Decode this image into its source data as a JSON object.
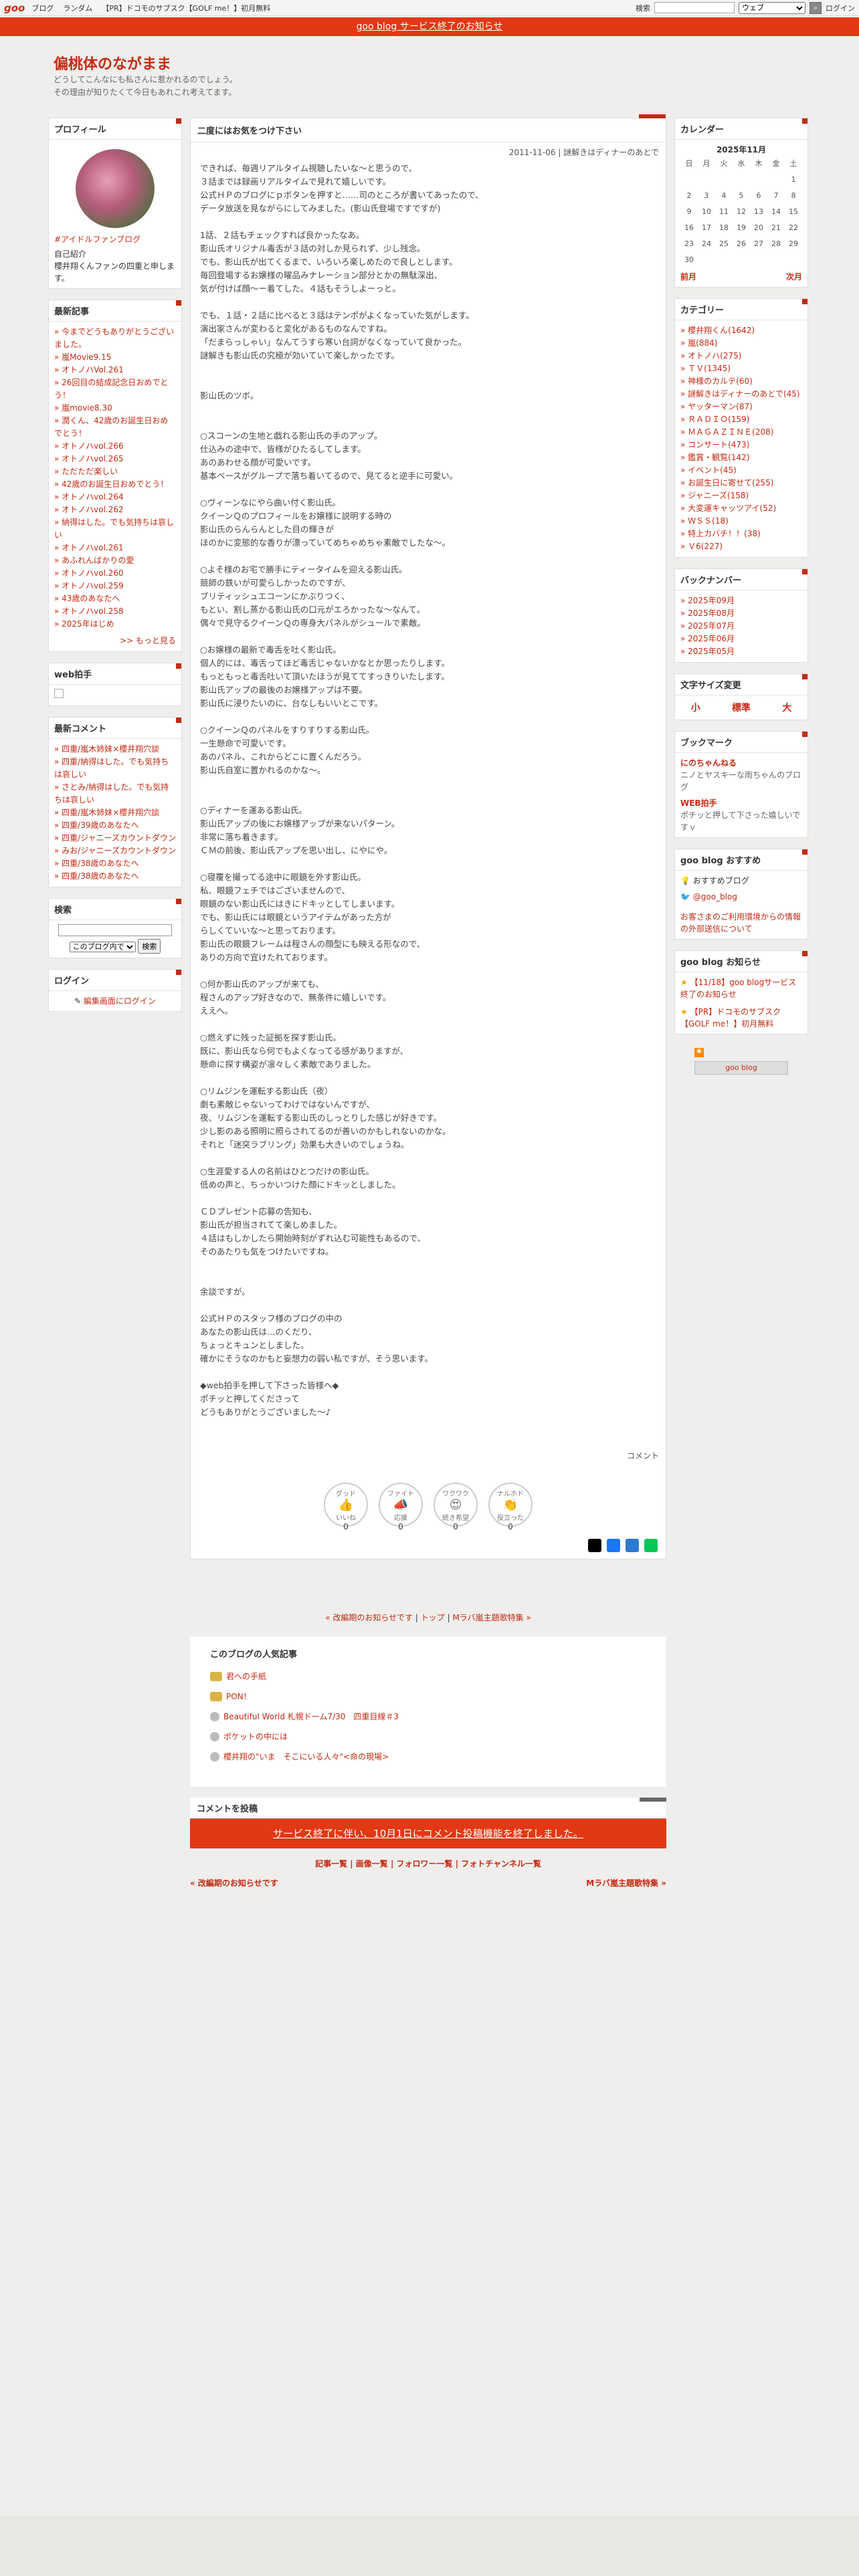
{
  "topbar": {
    "logo": "goo",
    "links": [
      "ブログ",
      "ランダム",
      "【PR】ドコモのサブスク【GOLF me！】初月無料"
    ],
    "search_label": "検索",
    "search_select": "ウェブ",
    "login": "ログイン"
  },
  "notice": "goo blog サービス終了のお知らせ",
  "blog": {
    "title": "偏桃体のながまま",
    "desc": "どうしてこんなにも私さんに惹かれるのでしょう。\nその理由が知りたくて今日もあれこれ考えてます。"
  },
  "profile": {
    "title": "プロフィール",
    "tag": "#アイドルファンブログ",
    "intro_label": "自己紹介",
    "intro": "櫻井翔くんファンの四重と申します。"
  },
  "recent": {
    "title": "最新記事",
    "items": [
      "今までどうもありがとうございました。",
      "嵐Movie9.15",
      "オトノハVol.261",
      "26回目の結成記念日おめでとう！",
      "嵐movie8.30",
      "潤くん、42歳のお誕生日おめでとう！",
      "オトノハvol.266",
      "オトノハvol.265",
      "ただただ楽しい",
      "42歳のお誕生日おめでとう！",
      "オトノハvol.264",
      "オトノハvol.262",
      "納得はした。でも気持ちは哀しい",
      "オトノハvol.261",
      "あふれんばかりの愛",
      "オトノハvol.260",
      "オトノハvol.259",
      "43歳のあなたへ",
      "オトノハvol.258",
      "2025年はじめ"
    ],
    "more": ">> もっと見る"
  },
  "webclap": {
    "title": "web拍手"
  },
  "comments": {
    "title": "最新コメント",
    "items": [
      "四重/嵐木姉妹×櫻井翔穴談",
      "四重/納得はした。でも気持ちは哀しい",
      "さとみ/納得はした。でも気持ちは哀しい",
      "四重/嵐木姉妹×櫻井翔穴談",
      "四重/39歳のあなたへ",
      "四重/ジャニーズカウントダウン",
      "みお/ジャニーズカウントダウン",
      "四重/38歳のあなたへ",
      "四重/38歳のあなたへ"
    ]
  },
  "search": {
    "title": "検索",
    "select": "このブログ内で",
    "button": "検索"
  },
  "login": {
    "title": "ログイン",
    "link": "編集画面にログイン"
  },
  "post": {
    "title": "二度にはお気をつけ下さい",
    "meta": "2011-11-06 | 謎解きはディナーのあとで",
    "body": "できれば、毎週リアルタイム視聴したいな～と思うので、\n３話までは録画リアルタイムで見れて嬉しいです。\n公式ＨＰのブログにｐボタンを押すと……司のところが書いてあったので、\nデータ放送を見ながらにしてみました。(影山氏登場ですですが)\n\n1話、２話もチェックすれば良かったなあ。\n影山氏オリジナル毒舌が３話の対しか見られず、少し残念。\nでも、影山氏が出てくるまで、いろいろ楽しめたので良しとします。\n毎回登場するお嬢様の曜品みナレーション部分とかの無駄深出、\n気が付けば顔〜ー着てした。４話もそうしよーっと。\n\nでも、１話・２話に比べると３話はテンポがよくなっていた気がします。\n演出家さんが変わると変化があるものなんですね。\n「だまらっしゃい」なんてうすら寒い台詞がなくなっていて良かった。\n謎解きも影山氏の究極が効いていて楽しかったです。\n\n\n影山氏のツボ。\n\n\n○スコーンの生地と戯れる影山氏の手のアップ。\n仕込みの途中で、皆様がひたるしてします。\nあのあわせる顔が可愛いです。\n基本ベースがグループで落ち着いてるので、見てると逆手に可愛い。\n\n○ヴィーンなにやら曲い付く影山氏。\nクイーンＱのプロフィールをお嬢様に説明する時の\n影山氏のらんらんとした目の輝きが\nほのかに変態的な香りが漂っていてめちゃめちゃ素敵でしたな〜。\n\n○よそ様のお宅で勝手にティータイムを迎える影山氏。\n競師の鉄いが可愛らしかったのですが、\nブリティッシュエコーンにかぶりつく、\nもとい、割し蒸かる影山氏の口元がエろかったな〜なんて。\n偶々で見守るクイーンＱの専身大パネルがシュールで素敵。\n\n○お嬢様の最新で毒舌を吐く影山氏。\n個人的には、毒舌ってほど毒舌じゃないかなとか思ったりします。\nもっともっと毒舌吐いて頂いたほうが見ててすっきりいたします。\n影山氏アップの最後のお嬢様アップは不要。\n影山氏に浸りたいのに、台なしもいいとこです。\n\n○クイーンＱのパネルをすりすりする影山氏。\n一生懸命で可愛いです。\nあのパネル、これからどこに置くんだろう。\n影山氏自室に置かれるのかな〜。\n\n\n○ディナーを運ある影山氏。\n影山氏アップの後にお嬢様アップが来ないパターン。\n非常に落ち着きます。\nＣＭの前後、影山氏アップを思い出し、にやにや。\n\n○寝覆を撮ってる途中に眼鏡を外す影山氏。\n私、眼鏡フェチではございませんので、\n眼鏡のない影山氏にはきにドキッとしてしまいます。\nでも、影山氏には眼鏡というアイテムがあった方が\nらしくていいな〜と思っております。\n影山氏の眼鏡フレームは程さんの顔型にも映える形なので、\nありの方向で宜けたれております。\n\n○何か影山氏のアップが来ても、\n程さんのアップ好きなので、無条件に嬉しいです。\nええへ。\n\n○燃えずに残った証拠を探す影山氏。\n既に、影山氏なら何でもよくなってる感がありますが、\n懸命に探す構姿が凛々しく素敵でありました。\n\n○リムジンを運転する影山氏（夜）\n劇も素敵じゃないってわけではないんですが、\n夜、リムジンを運転する影山氏のしっとりした感じが好きです。\n少し影のある照明に照らされてるのが善いのかもしれないのかな。\nそれと「迷突ラブリング」効果も大きいのでしょうね。\n\n○生涯愛する人の名前はひとつだけの影山氏。\n低めの声と、ちっかいつけた顔にドキッとしました。\n\nＣＤプレゼント応募の告知も、\n影山氏が担当されてて楽しめました。\n４話はもしかしたら開始時刻がずれ込む可能性もあるので、\nそのあたりも気をつけたいですね。\n\n\n余談ですが。\n\n公式ＨＰのスタッフ様のブログの中の\nあなたの影山氏は…のくだり、\nちょっとキュンとしました。\n確かにそうなのかもと妄想力の弱い私ですが、そう思います。\n\n◆web拍手を押して下さった皆様へ◆\nポチッと押してくださって\nどうもありがとうございました〜♪",
    "comment_label": "コメント"
  },
  "reactions": [
    {
      "top": "グッド",
      "label": "いいね",
      "count": "0",
      "emoji": "👍"
    },
    {
      "top": "ファイト",
      "label": "応援",
      "count": "0",
      "emoji": "📣"
    },
    {
      "top": "ワクワク",
      "label": "続き希望",
      "count": "0",
      "emoji": "😍"
    },
    {
      "top": "ナルホド",
      "label": "役立った",
      "count": "0",
      "emoji": "👏"
    }
  ],
  "share_colors": [
    "#000000",
    "#1877f2",
    "#2e7ad1",
    "#06c755"
  ],
  "nav": {
    "prev": "« 改編期のお知らせです",
    "top": "トップ",
    "next": "Mラバ嵐主題歌特集 »"
  },
  "popular": {
    "title": "このブログの人気記事",
    "items": [
      "君への手紙",
      "PON！",
      "Beautiful World 札幌ドーム7/30　四重目線＃3",
      "ポケットの中には",
      "櫻井翔の\"いま　そこにいる人々\"<命の現場>"
    ]
  },
  "comment_post": {
    "title": "コメントを投稿",
    "closed": "サービス終了に伴い、10月1日にコメント投稿機能を終了しました。"
  },
  "footer_links": "記事一覧 | 画像一覧 | フォロワー一覧 | フォトチャンネル一覧",
  "footer_prev": "« 改編期のお知らせです",
  "footer_next": "Mラバ嵐主題歌特集 »",
  "calendar": {
    "title": "カレンダー",
    "month": "2025年11月",
    "days": [
      "日",
      "月",
      "火",
      "水",
      "木",
      "金",
      "土"
    ],
    "weeks": [
      [
        "",
        "",
        "",
        "",
        "",
        "",
        "1"
      ],
      [
        "2",
        "3",
        "4",
        "5",
        "6",
        "7",
        "8"
      ],
      [
        "9",
        "10",
        "11",
        "12",
        "13",
        "14",
        "15"
      ],
      [
        "16",
        "17",
        "18",
        "19",
        "20",
        "21",
        "22"
      ],
      [
        "23",
        "24",
        "25",
        "26",
        "27",
        "28",
        "29"
      ],
      [
        "30",
        "",
        "",
        "",
        "",
        "",
        ""
      ]
    ],
    "prev": "前月",
    "next": "次月"
  },
  "categories": {
    "title": "カテゴリー",
    "items": [
      "櫻井翔くん(1642)",
      "嵐(884)",
      "オトノハ(275)",
      "ＴＶ(1345)",
      "神様のカルテ(60)",
      "謎解きはディナーのあとで(45)",
      "ヤッターマン(87)",
      "ＲＡＤＩＯ(159)",
      "ＭＡＧＡＺＩＮＥ(208)",
      "コンサート(473)",
      "鑑賞・観覧(142)",
      "イベント(45)",
      "お誕生日に寄せて(255)",
      "ジャニーズ(158)",
      "大変運キャッツアイ(52)",
      "ＷＳＳ(18)",
      "特上カバチ！！(38)",
      "Ｖ6(227)"
    ]
  },
  "backnumber": {
    "title": "バックナンバー",
    "items": [
      "2025年09月",
      "2025年08月",
      "2025年07月",
      "2025年06月",
      "2025年05月"
    ]
  },
  "fontsize": {
    "title": "文字サイズ変更",
    "small": "小",
    "normal": "標準",
    "large": "大"
  },
  "bookmark": {
    "title": "ブックマーク",
    "items": [
      {
        "name": "にのちゃんねる",
        "desc": "ニノとヤスキーな雨ちゃんのブログ"
      },
      {
        "name": "WEB拍手",
        "desc": "ポチッと押して下さった嬉しいですｖ"
      }
    ]
  },
  "goo_rec": {
    "title": "goo blog おすすめ",
    "items": [
      "おすすめブログ",
      "@goo_blog"
    ],
    "note": "お客さまのご利用環境からの情報の外部送信について"
  },
  "goo_notice": {
    "title": "goo blog お知らせ",
    "items": [
      "【11/18】goo blogサービス終了のお知らせ",
      "【PR】ドコモのサブスク【GOLF me！】初月無料"
    ],
    "badge": "goo blog"
  }
}
